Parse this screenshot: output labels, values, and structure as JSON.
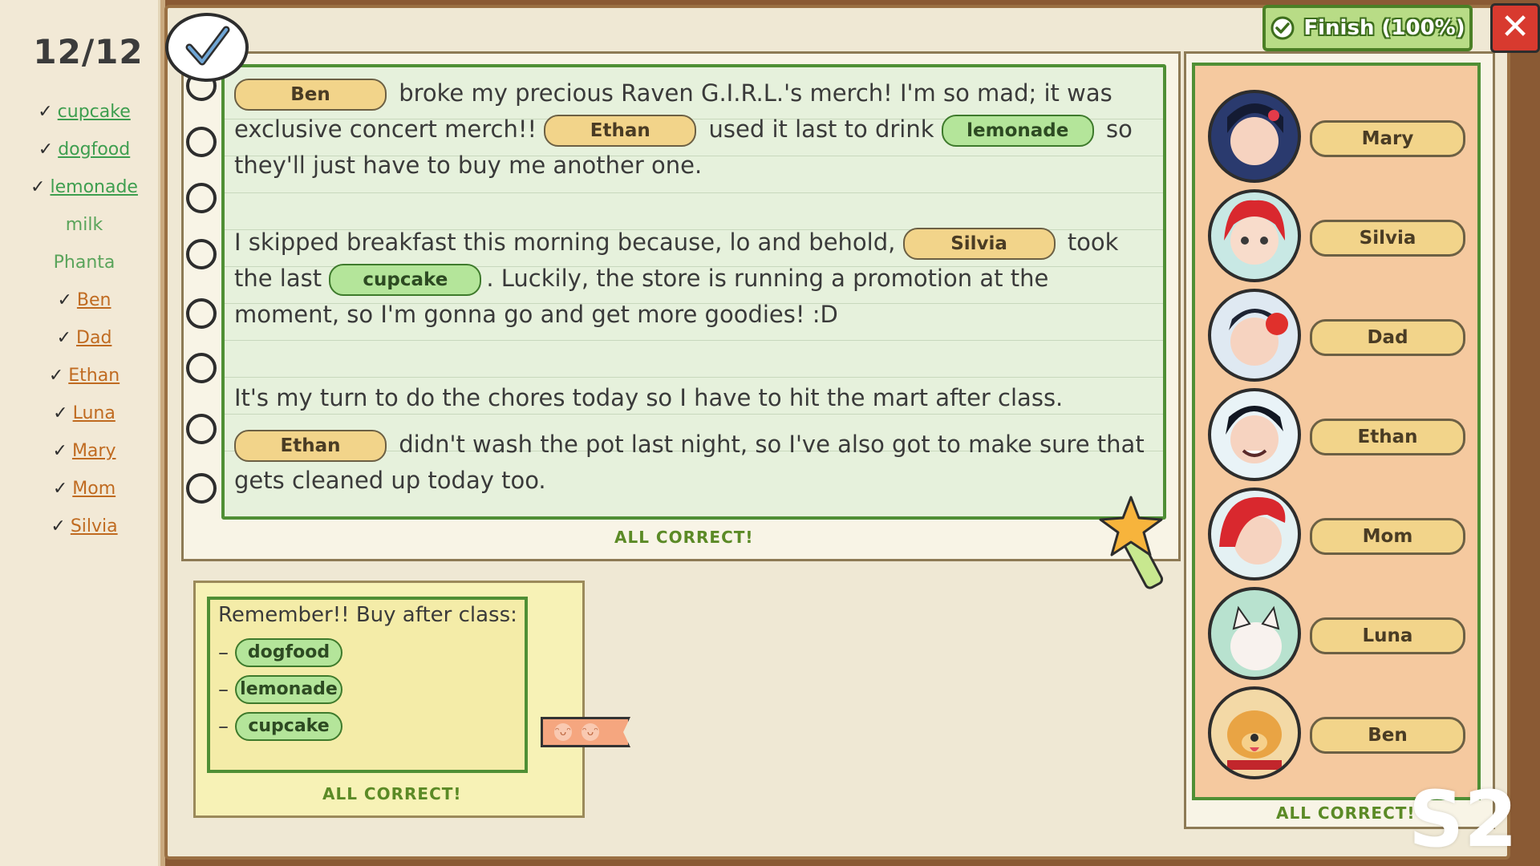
{
  "sidebar": {
    "count": "12/12",
    "items": [
      {
        "label": "cupcake",
        "kind": "word",
        "checked": true
      },
      {
        "label": "dogfood",
        "kind": "word",
        "checked": true
      },
      {
        "label": "lemonade",
        "kind": "word",
        "checked": true
      },
      {
        "label": "milk",
        "kind": "plain",
        "checked": false
      },
      {
        "label": "Phanta",
        "kind": "plain",
        "checked": false
      },
      {
        "label": "Ben",
        "kind": "person",
        "checked": true
      },
      {
        "label": "Dad",
        "kind": "person",
        "checked": true
      },
      {
        "label": "Ethan",
        "kind": "person",
        "checked": true
      },
      {
        "label": "Luna",
        "kind": "person",
        "checked": true
      },
      {
        "label": "Mary",
        "kind": "person",
        "checked": true
      },
      {
        "label": "Mom",
        "kind": "person",
        "checked": true
      },
      {
        "label": "Silvia",
        "kind": "person",
        "checked": true
      }
    ]
  },
  "notebook": {
    "p1": {
      "tag1": "Ben",
      "t1": "broke my precious Raven G.I.R.L.'s merch!  I'm so mad; it was exclusive concert merch!!",
      "tag2": "Ethan",
      "t2": "used it last to drink",
      "tag3": "lemonade",
      "t3": "so they'll just have to buy me another one."
    },
    "p2": {
      "t1": "I skipped breakfast this morning because, lo and behold,",
      "tag1": "Silvia",
      "t2": "took the last",
      "tag2": "cupcake",
      "t3": ". Luckily, the store is running a promotion at the moment, so I'm gonna go and get more goodies! :D"
    },
    "p3": {
      "t1": "It's my turn to do the chores today so I have to hit the mart after class.",
      "tag1": "Ethan",
      "t2": "didn't wash the pot last night, so I've also got to make sure that gets cleaned up today too."
    },
    "status": "ALL CORRECT!"
  },
  "sticky": {
    "title": "Remember!! Buy after class:",
    "dash": "–",
    "items": [
      "dogfood",
      "lemonade",
      "cupcake"
    ],
    "status": "ALL CORRECT!"
  },
  "characters": {
    "names": [
      "Mary",
      "Silvia",
      "Dad",
      "Ethan",
      "Mom",
      "Luna",
      "Ben"
    ],
    "status": "ALL CORRECT!"
  },
  "top": {
    "finish_label": "Finish (100%)",
    "close_symbol": "✕"
  },
  "stage": "S2",
  "colors": {
    "accent_green": "#4f8f35",
    "name_tag": "#f2d48a",
    "item_tag": "#b4e59a",
    "close_red": "#d83a2f"
  }
}
